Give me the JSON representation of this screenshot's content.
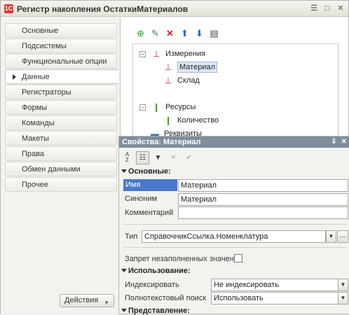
{
  "window": {
    "title": "Регистр накопления ОстаткиМатериалов",
    "icon": "1C"
  },
  "nav": {
    "items": [
      {
        "label": "Основные"
      },
      {
        "label": "Подсистемы"
      },
      {
        "label": "Функциональные опции"
      },
      {
        "label": "Данные",
        "active": true
      },
      {
        "label": "Регистраторы"
      },
      {
        "label": "Формы"
      },
      {
        "label": "Команды"
      },
      {
        "label": "Макеты"
      },
      {
        "label": "Права"
      },
      {
        "label": "Обмен данными"
      },
      {
        "label": "Прочее"
      }
    ],
    "actions_label": "Действия"
  },
  "toolbar_icons": [
    "add-icon",
    "edit-icon",
    "delete-icon",
    "move-up-icon",
    "move-down-icon",
    "list-icon"
  ],
  "tree": {
    "dimensions_label": "Измерения",
    "dim_1": "Материал",
    "dim_2": "Склад",
    "resources_label": "Ресурсы",
    "res_1": "Количество",
    "attributes_label": "Реквизиты"
  },
  "props": {
    "title": "Свойства: Материал",
    "section_main": "Основные:",
    "name_label": "Имя",
    "name_value": "Материал",
    "synonym_label": "Синоним",
    "synonym_value": "Материал",
    "comment_label": "Комментарий",
    "comment_value": "",
    "type_label": "Тип",
    "type_value": "СправочникСсылка.Номенклатура",
    "type_button": "...",
    "deny_empty_label": "Запрет незаполненных значен",
    "section_usage": "Использование:",
    "index_label": "Индексировать",
    "index_value": "Не индексировать",
    "fulltext_label": "Полнотекстовый поиск",
    "fulltext_value": "Использовать",
    "section_view": "Представление:"
  }
}
